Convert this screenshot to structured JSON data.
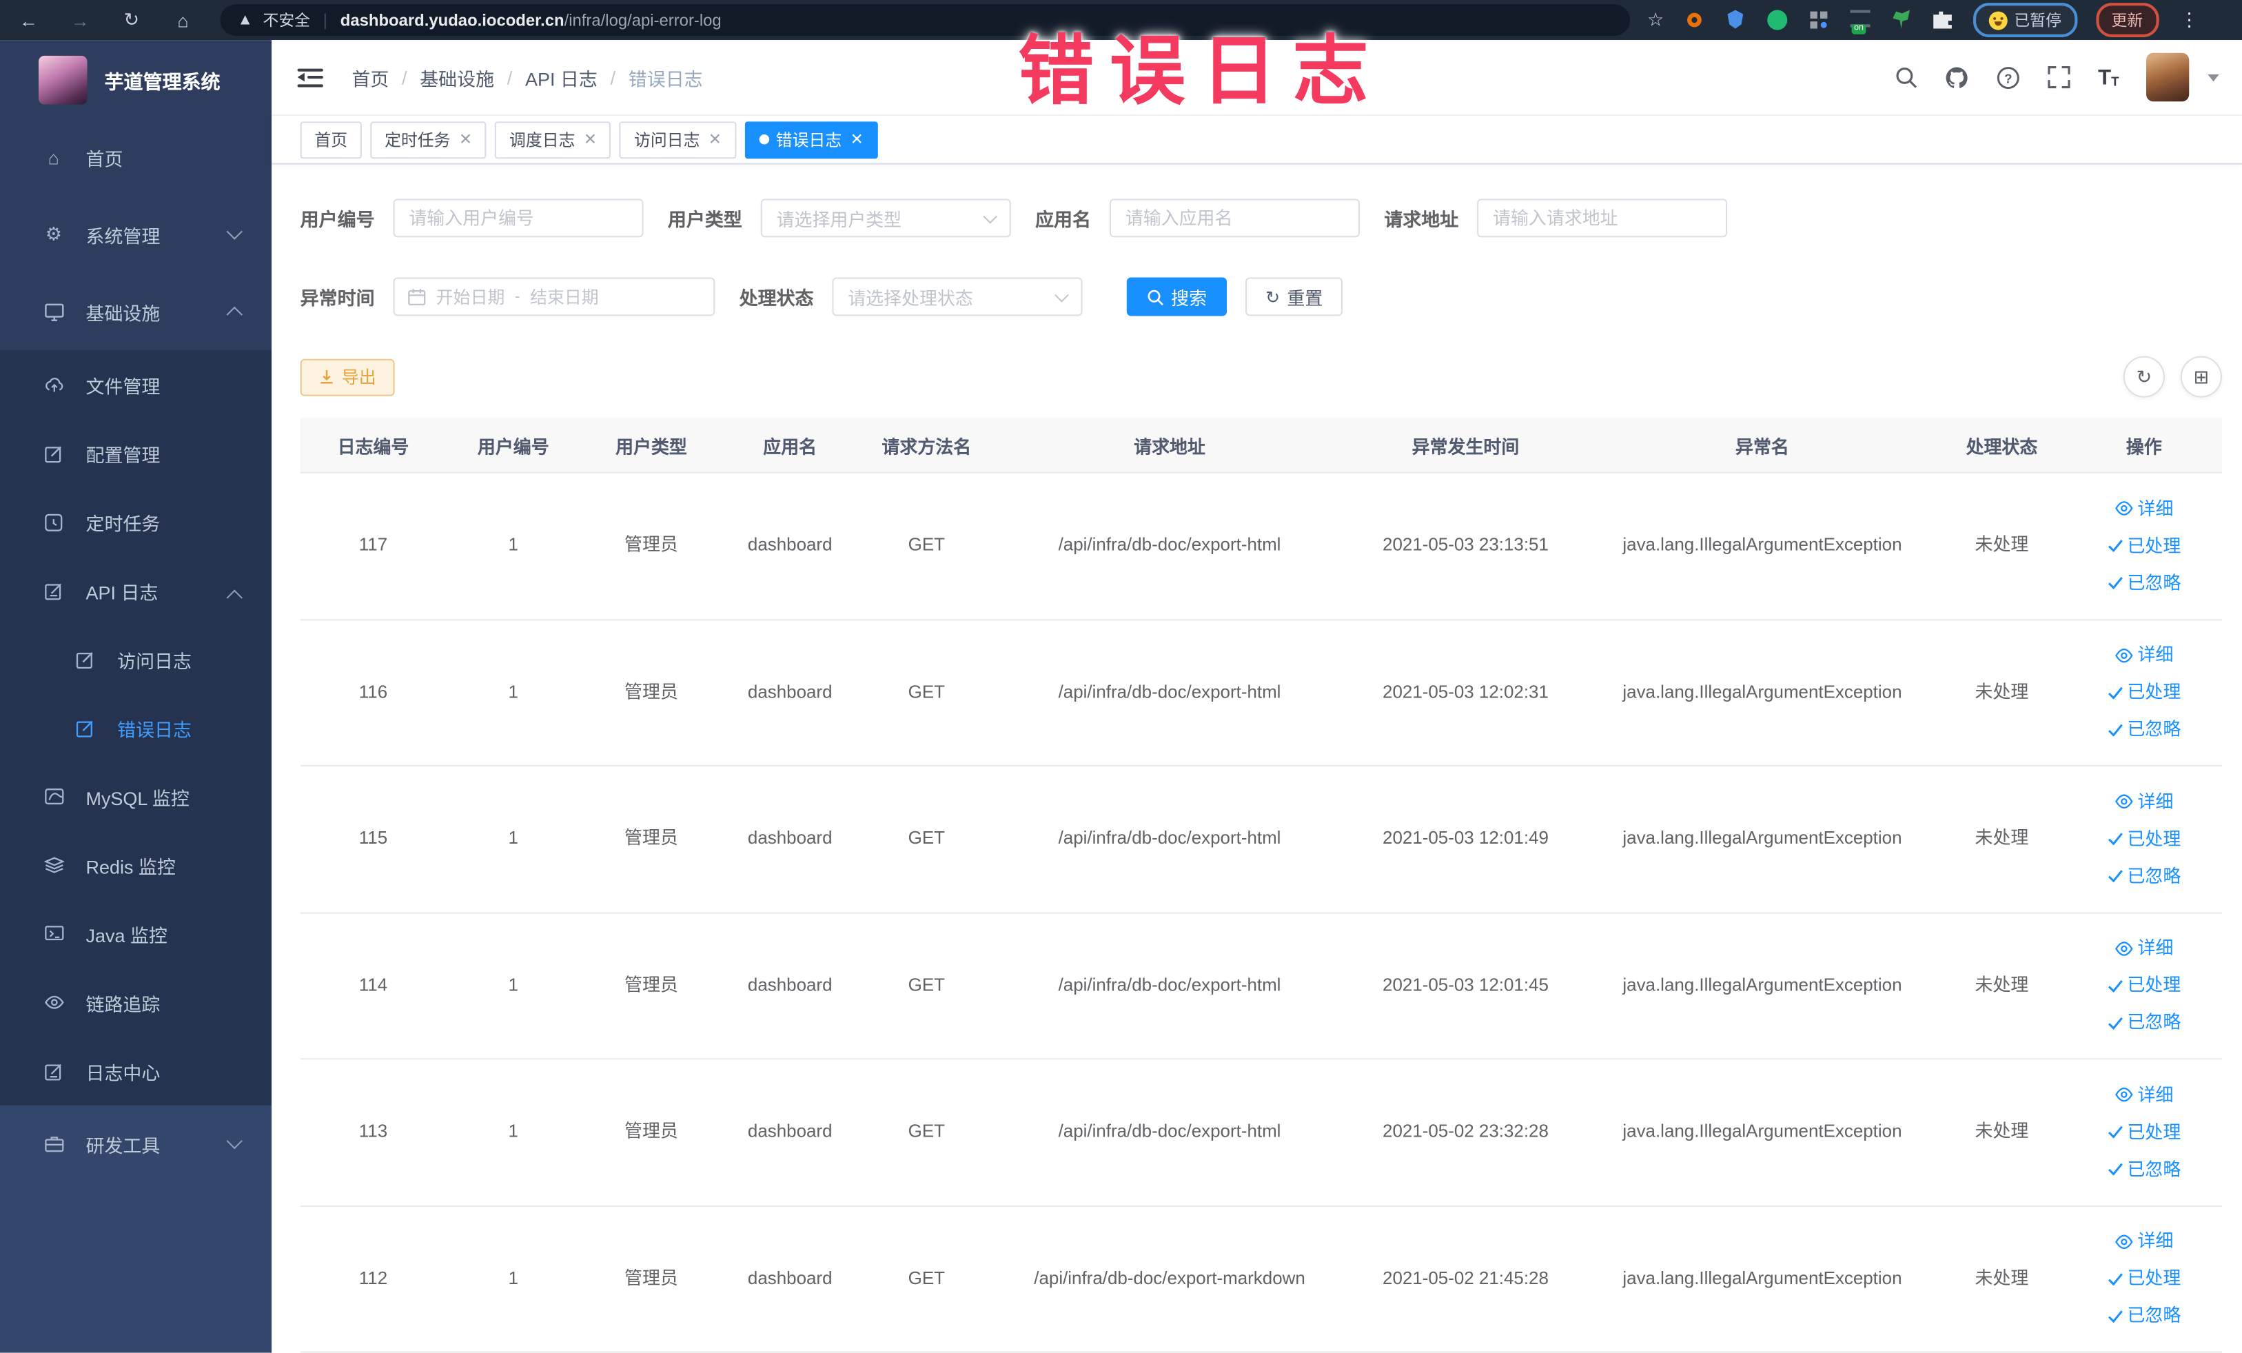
{
  "watermark": "错误日志",
  "browser": {
    "security_label": "不安全",
    "url_domain": "dashboard.yudao.iocoder.cn",
    "url_path": "/infra/log/api-error-log",
    "paused_badge": "已暂停",
    "update_button": "更新",
    "extension_icons": [
      "ext-orange-ring",
      "ext-blue-shield",
      "ext-green-y",
      "ext-grid",
      "ext-switch",
      "ext-sprout",
      "ext-puzzle"
    ]
  },
  "sidebar": {
    "app_title": "芋道管理系统",
    "items": [
      {
        "label": "首页",
        "icon": "home-icon"
      },
      {
        "label": "系统管理",
        "icon": "gear-icon",
        "chevron": "down"
      },
      {
        "label": "基础设施",
        "icon": "monitor-icon",
        "chevron": "up"
      },
      {
        "label": "文件管理",
        "icon": "upload-icon"
      },
      {
        "label": "配置管理",
        "icon": "edit-icon"
      },
      {
        "label": "定时任务",
        "icon": "clock-icon"
      },
      {
        "label": "API 日志",
        "icon": "log-icon",
        "chevron": "up"
      },
      {
        "label": "访问日志",
        "icon": "log-icon"
      },
      {
        "label": "错误日志",
        "icon": "log-icon",
        "active": true
      },
      {
        "label": "MySQL 监控",
        "icon": "mysql-icon"
      },
      {
        "label": "Redis 监控",
        "icon": "redis-icon"
      },
      {
        "label": "Java 监控",
        "icon": "java-icon"
      },
      {
        "label": "链路追踪",
        "icon": "trace-icon"
      },
      {
        "label": "日志中心",
        "icon": "log-center-icon"
      },
      {
        "label": "研发工具",
        "icon": "toolbox-icon",
        "chevron": "down"
      }
    ]
  },
  "header": {
    "breadcrumb": [
      "首页",
      "基础设施",
      "API 日志",
      "错误日志"
    ]
  },
  "tabs": [
    {
      "label": "首页",
      "active": false,
      "closable": false
    },
    {
      "label": "定时任务",
      "active": false,
      "closable": true
    },
    {
      "label": "调度日志",
      "active": false,
      "closable": true
    },
    {
      "label": "访问日志",
      "active": false,
      "closable": true
    },
    {
      "label": "错误日志",
      "active": true,
      "closable": true
    }
  ],
  "filters": {
    "user_id": {
      "label": "用户编号",
      "placeholder": "请输入用户编号"
    },
    "user_type": {
      "label": "用户类型",
      "placeholder": "请选择用户类型"
    },
    "app_name": {
      "label": "应用名",
      "placeholder": "请输入应用名"
    },
    "request_url": {
      "label": "请求地址",
      "placeholder": "请输入请求地址"
    },
    "exception_time": {
      "label": "异常时间",
      "start_placeholder": "开始日期",
      "separator": "-",
      "end_placeholder": "结束日期"
    },
    "process_status": {
      "label": "处理状态",
      "placeholder": "请选择处理状态"
    },
    "search_button": "搜索",
    "reset_button": "重置"
  },
  "toolbar": {
    "export_button": "导出"
  },
  "table": {
    "headers": [
      "日志编号",
      "用户编号",
      "用户类型",
      "应用名",
      "请求方法名",
      "请求地址",
      "异常发生时间",
      "异常名",
      "处理状态",
      "操作"
    ],
    "col_keys": [
      "id",
      "user_id",
      "user_type",
      "app_name",
      "method",
      "url",
      "time",
      "exception",
      "status"
    ],
    "row_actions": [
      {
        "name": "detail",
        "label": "详细",
        "icon": "eye"
      },
      {
        "name": "processed",
        "label": "已处理",
        "icon": "check"
      },
      {
        "name": "ignored",
        "label": "已忽略",
        "icon": "check"
      }
    ],
    "rows": [
      {
        "id": "117",
        "user_id": "1",
        "user_type": "管理员",
        "app_name": "dashboard",
        "method": "GET",
        "url": "/api/infra/db-doc/export-html",
        "time": "2021-05-03 23:13:51",
        "exception": "java.lang.IllegalArgumentException",
        "status": "未处理"
      },
      {
        "id": "116",
        "user_id": "1",
        "user_type": "管理员",
        "app_name": "dashboard",
        "method": "GET",
        "url": "/api/infra/db-doc/export-html",
        "time": "2021-05-03 12:02:31",
        "exception": "java.lang.IllegalArgumentException",
        "status": "未处理"
      },
      {
        "id": "115",
        "user_id": "1",
        "user_type": "管理员",
        "app_name": "dashboard",
        "method": "GET",
        "url": "/api/infra/db-doc/export-html",
        "time": "2021-05-03 12:01:49",
        "exception": "java.lang.IllegalArgumentException",
        "status": "未处理"
      },
      {
        "id": "114",
        "user_id": "1",
        "user_type": "管理员",
        "app_name": "dashboard",
        "method": "GET",
        "url": "/api/infra/db-doc/export-html",
        "time": "2021-05-03 12:01:45",
        "exception": "java.lang.IllegalArgumentException",
        "status": "未处理"
      },
      {
        "id": "113",
        "user_id": "1",
        "user_type": "管理员",
        "app_name": "dashboard",
        "method": "GET",
        "url": "/api/infra/db-doc/export-html",
        "time": "2021-05-02 23:32:28",
        "exception": "java.lang.IllegalArgumentException",
        "status": "未处理"
      },
      {
        "id": "112",
        "user_id": "1",
        "user_type": "管理员",
        "app_name": "dashboard",
        "method": "GET",
        "url": "/api/infra/db-doc/export-markdown",
        "time": "2021-05-02 21:45:28",
        "exception": "java.lang.IllegalArgumentException",
        "status": "未处理"
      }
    ]
  },
  "colors": {
    "primary": "#1890ff",
    "sidebar_bg": "#2e3d5e",
    "sidebar_submenu_bg": "#253350",
    "active_menu_text": "#409eff",
    "warning_button": "#e6a23c",
    "watermark": "#f43b5f"
  }
}
